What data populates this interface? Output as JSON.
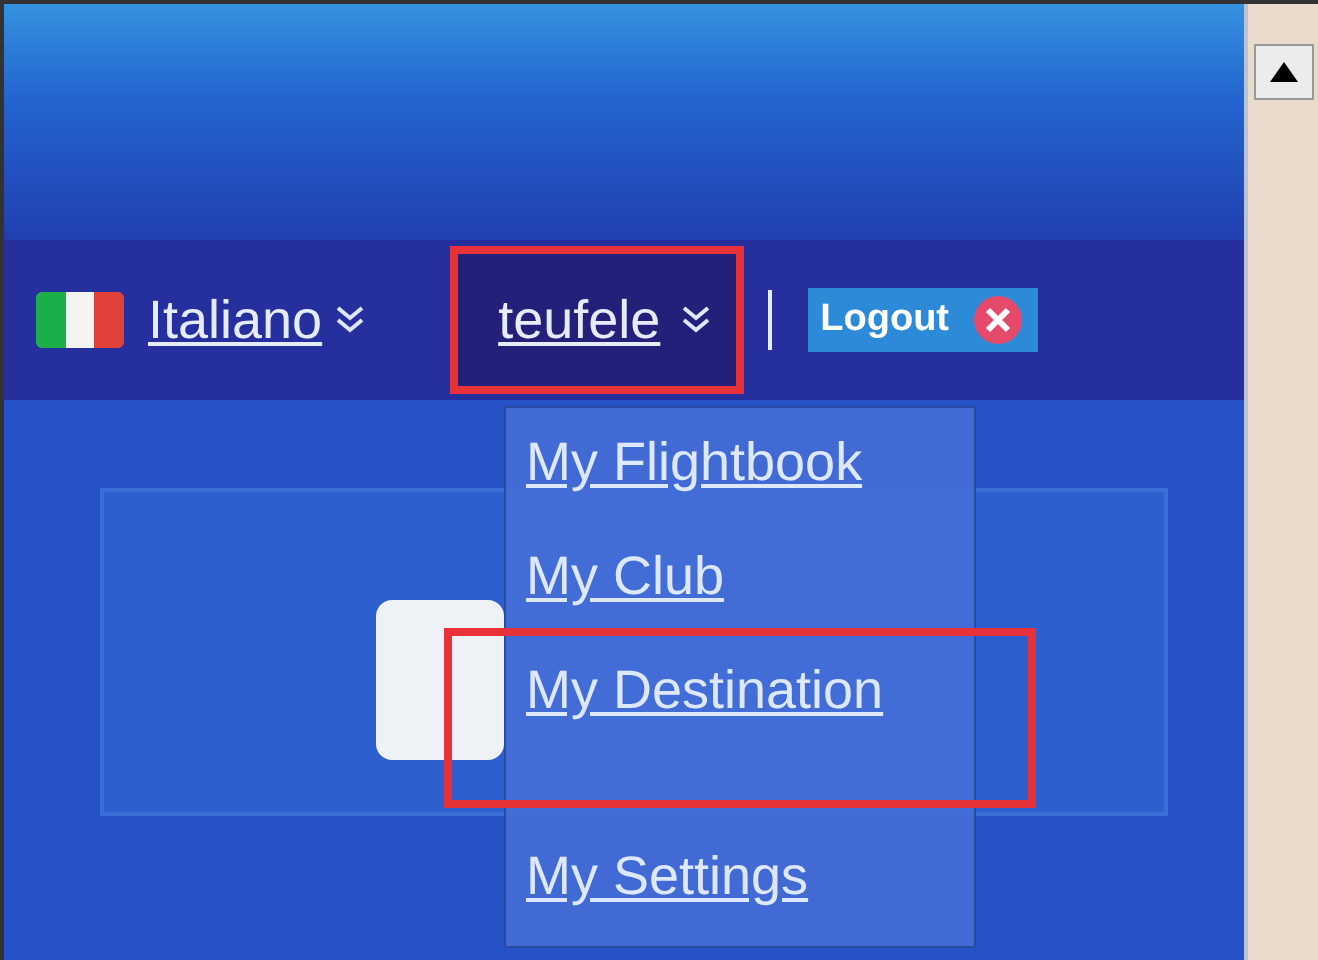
{
  "language": {
    "label": "Italiano"
  },
  "user_menu": {
    "label": "teufele",
    "expanded": true,
    "highlighted": true,
    "items": [
      {
        "label": "My Flightbook",
        "highlighted": false
      },
      {
        "label": "My Club",
        "highlighted": false
      },
      {
        "label": "My Destination",
        "highlighted": true
      },
      {
        "label": "My Settings",
        "highlighted": false
      }
    ]
  },
  "logout": {
    "label": "Logout"
  }
}
